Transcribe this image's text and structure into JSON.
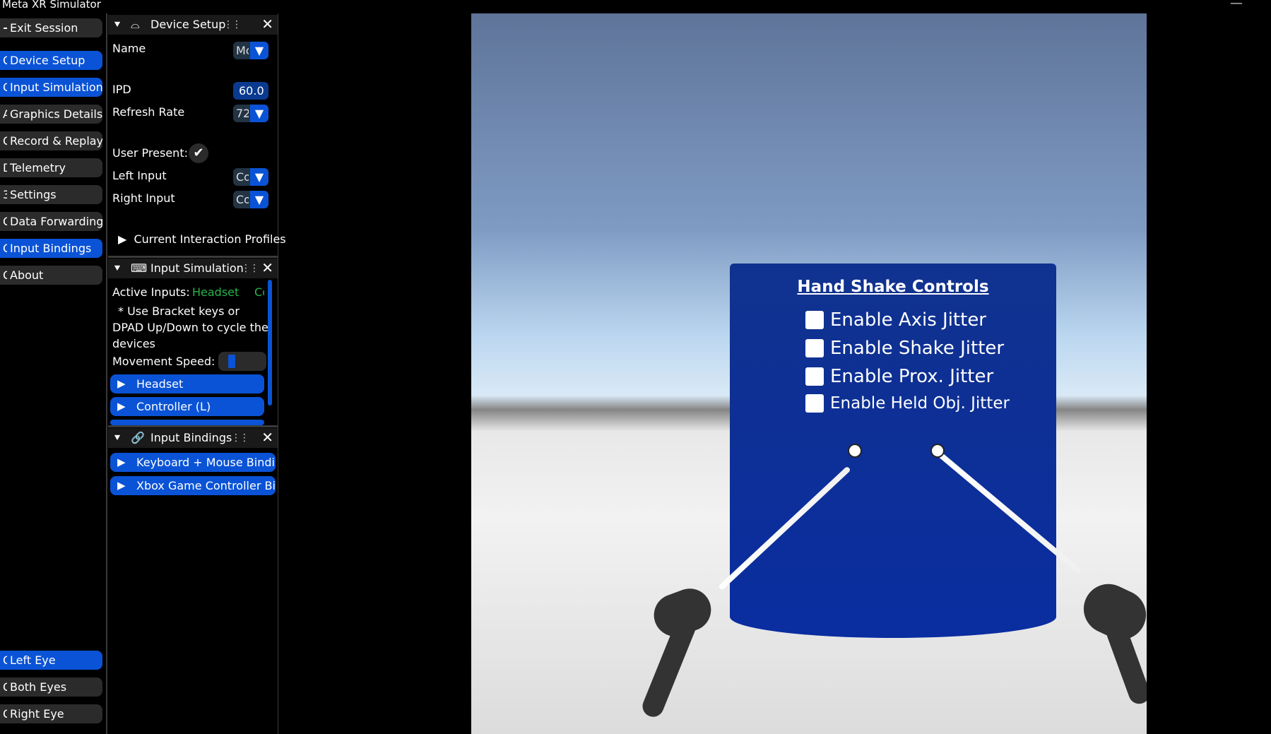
{
  "app": {
    "title": "Meta XR Simulator",
    "minimize": "—"
  },
  "nav": {
    "exit": "Exit Session",
    "items": [
      {
        "label": "Device Setup",
        "active": true
      },
      {
        "label": "Input Simulation",
        "active": true
      },
      {
        "label": "Graphics Details",
        "active": false
      },
      {
        "label": "Record & Replay",
        "active": false
      },
      {
        "label": "Telemetry",
        "active": false
      },
      {
        "label": "Settings",
        "active": false
      },
      {
        "label": "Data Forwarding",
        "active": false
      },
      {
        "label": "Input Bindings",
        "active": true
      },
      {
        "label": "About",
        "active": false
      }
    ],
    "eyes": [
      {
        "label": "Left Eye",
        "active": true
      },
      {
        "label": "Both Eyes",
        "active": false
      },
      {
        "label": "Right Eye",
        "active": false
      }
    ]
  },
  "device_setup": {
    "title": "Device Setup",
    "name_label": "Name",
    "name_value": "Mc",
    "ipd_label": "IPD",
    "ipd_value": "60.0",
    "refresh_label": "Refresh Rate",
    "refresh_value": "72",
    "user_present_label": "User Present:",
    "left_input_label": "Left Input",
    "left_input_value": "Co",
    "right_input_label": "Right Input",
    "right_input_value": "Co",
    "profiles_label": "Current Interaction Profiles"
  },
  "input_simulation": {
    "title": "Input Simulation",
    "active_label": "Active Inputs:",
    "active_headset": "Headset",
    "active_more": "Cc",
    "hint_line1": "* Use Bracket keys or",
    "hint_line2": "DPAD Up/Down to cycle the",
    "hint_line3": "devices",
    "speed_label": "Movement Speed:",
    "headset_btn": "Headset",
    "controller_l_btn": "Controller (L)"
  },
  "input_bindings": {
    "title": "Input Bindings",
    "keyboard_btn": "Keyboard + Mouse Bindin",
    "xbox_btn": "Xbox Game Controller Bin"
  },
  "scene": {
    "board_title": "Hand Shake Controls",
    "options": [
      "Enable Axis Jitter",
      "Enable Shake Jitter",
      "Enable Prox. Jitter",
      "Enable Held Obj. Jitter"
    ]
  }
}
